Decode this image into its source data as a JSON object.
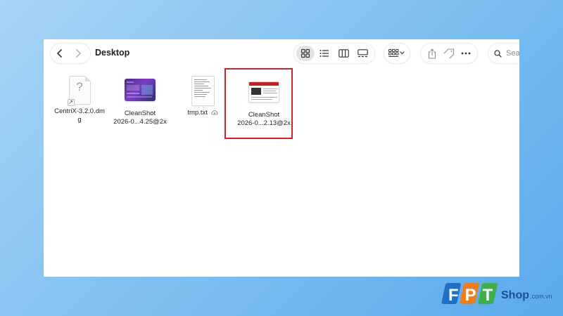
{
  "window": {
    "title": "Desktop"
  },
  "search": {
    "placeholder": "Sear"
  },
  "files": [
    {
      "line1": "CentriX-3.2.0.dm",
      "line2": "g"
    },
    {
      "line1": "CleanShot",
      "line2": "2026-0...4.25@2x"
    },
    {
      "line1": "tmp.txt",
      "line2": ""
    },
    {
      "line1": "CleanShot",
      "line2": "2026-0...2.13@2x"
    }
  ],
  "selected_file_index": 3,
  "brand": {
    "fpt": "FPT",
    "shop": "Shop",
    "domain": ".com.vn"
  },
  "colors": {
    "highlight": "#c8242b",
    "fpt_blue": "#1f6fc5",
    "fpt_orange": "#f07c1c",
    "fpt_green": "#3eae49"
  }
}
